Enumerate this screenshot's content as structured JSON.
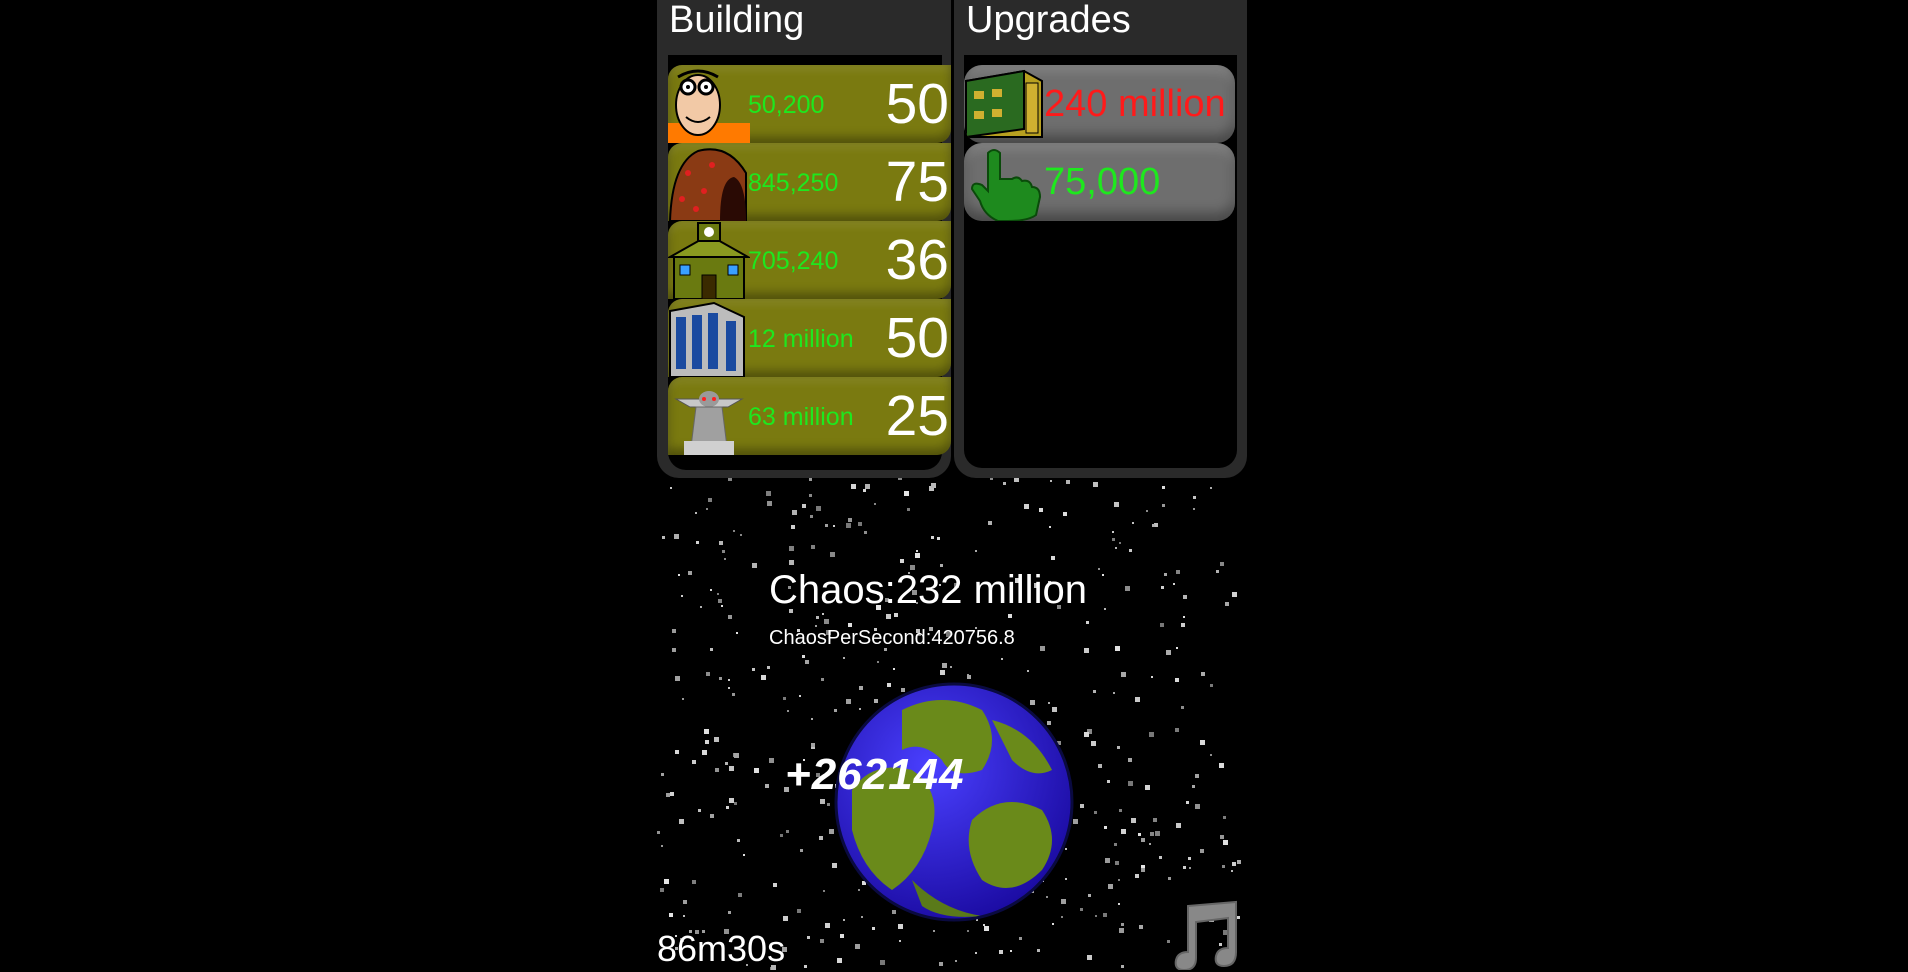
{
  "building": {
    "title": "Building",
    "items": [
      {
        "icon": "scientist-icon",
        "price": "50,200",
        "count": "50"
      },
      {
        "icon": "cave-icon",
        "price": "845,250",
        "count": "75"
      },
      {
        "icon": "school-icon",
        "price": "705,240",
        "count": "36"
      },
      {
        "icon": "office-building-icon",
        "price": "12 million",
        "count": "50"
      },
      {
        "icon": "statue-icon",
        "price": "63 million",
        "count": "25"
      }
    ]
  },
  "upgrades": {
    "title": "Upgrades",
    "items": [
      {
        "icon": "building-upgrade-icon",
        "price": "240 million",
        "price_color": "#ff1a1a"
      },
      {
        "icon": "hand-cursor-icon",
        "price": "75,000",
        "price_color": "#1ee81e"
      }
    ]
  },
  "stats": {
    "chaos": "Chaos:232 million",
    "chaos_per_second": "ChaosPerSecond:420756.8"
  },
  "click_popup": "+262144",
  "timer": "86m30s",
  "music_icon": "music-note-icon",
  "colors": {
    "price_affordable": "#1ee81e",
    "price_unaffordable": "#ff1a1a",
    "building_row": "#7a7a10",
    "upgrade_row": "#6e6e6e",
    "panel": "#2a2a2a"
  }
}
